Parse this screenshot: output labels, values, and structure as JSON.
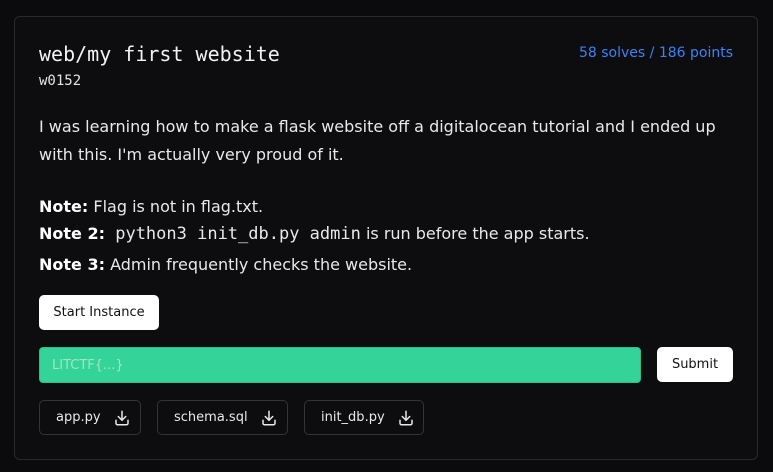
{
  "challenge": {
    "title": "web/my first website",
    "author": "w0152",
    "score": "58 solves / 186 points",
    "description": "I was learning how to make a flask website off a digitalocean tutorial and I ended up with this. I'm actually very proud of it.",
    "notes": [
      {
        "label": "Note:",
        "text": " Flag is not in flag.txt."
      },
      {
        "label": "Note 2:",
        "code": " python3 init_db.py admin",
        "text": " is run before the app starts."
      },
      {
        "label": "Note 3:",
        "text": " Admin frequently checks the website."
      }
    ]
  },
  "actions": {
    "start_instance_label": "Start Instance",
    "flag_placeholder": "LITCTF{...}",
    "submit_label": "Submit"
  },
  "files": [
    {
      "name": "app.py",
      "icon": "download-icon"
    },
    {
      "name": "schema.sql",
      "icon": "download-icon"
    },
    {
      "name": "init_db.py",
      "icon": "download-icon"
    }
  ],
  "colors": {
    "accent_blue": "#3b82f6",
    "flag_input_green": "#34d399",
    "background": "#0b0b0d"
  }
}
